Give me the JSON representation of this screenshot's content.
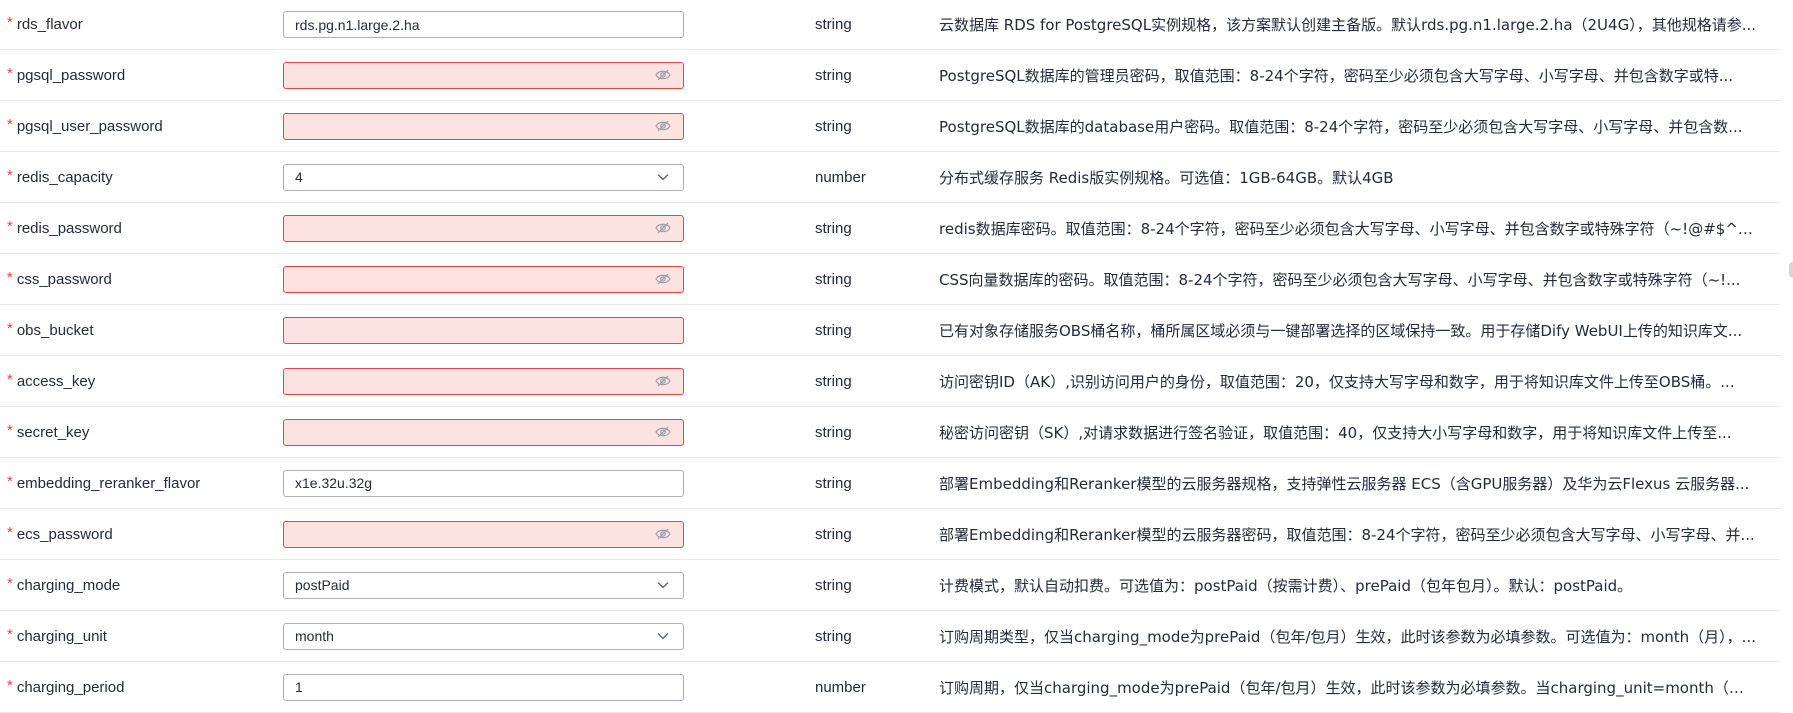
{
  "rows": [
    {
      "name": "rds_flavor",
      "kind": "text",
      "value": "rds.pg.n1.large.2.ha",
      "type": "string",
      "desc": "云数据库 RDS for PostgreSQL实例规格，该方案默认创建主备版。默认rds.pg.n1.large.2.ha（2U4G），其他规格请参..."
    },
    {
      "name": "pgsql_password",
      "kind": "password",
      "value": "",
      "type": "string",
      "desc": "PostgreSQL数据库的管理员密码，取值范围：8-24个字符，密码至少必须包含大写字母、小写字母、并包含数字或特..."
    },
    {
      "name": "pgsql_user_password",
      "kind": "password",
      "value": "",
      "type": "string",
      "desc": "PostgreSQL数据库的database用户密码。取值范围：8-24个字符，密码至少必须包含大写字母、小写字母、并包含数..."
    },
    {
      "name": "redis_capacity",
      "kind": "select",
      "value": "4",
      "type": "number",
      "desc": "分布式缓存服务 Redis版实例规格。可选值：1GB-64GB。默认4GB"
    },
    {
      "name": "redis_password",
      "kind": "password",
      "value": "",
      "type": "string",
      "desc": "redis数据库密码。取值范围：8-24个字符，密码至少必须包含大写字母、小写字母、并包含数字或特殊字符（~!@#$^*-..."
    },
    {
      "name": "css_password",
      "kind": "password",
      "value": "",
      "type": "string",
      "desc": "CSS向量数据库的密码。取值范围：8-24个字符，密码至少必须包含大写字母、小写字母、并包含数字或特殊字符（~!..."
    },
    {
      "name": "obs_bucket",
      "kind": "text-error",
      "value": "",
      "type": "string",
      "desc": "已有对象存储服务OBS桶名称，桶所属区域必须与一键部署选择的区域保持一致。用于存储Dify WebUI上传的知识库文..."
    },
    {
      "name": "access_key",
      "kind": "password",
      "value": "",
      "type": "string",
      "desc": "访问密钥ID（AK）,识别访问用户的身份，取值范围：20，仅支持大写字母和数字，用于将知识库文件上传至OBS桶。..."
    },
    {
      "name": "secret_key",
      "kind": "password",
      "value": "",
      "type": "string",
      "desc": "秘密访问密钥（SK）,对请求数据进行签名验证，取值范围：40，仅支持大小写字母和数字，用于将知识库文件上传至..."
    },
    {
      "name": "embedding_reranker_flavor",
      "kind": "text",
      "value": "x1e.32u.32g",
      "type": "string",
      "desc": "部署Embedding和Reranker模型的云服务器规格，支持弹性云服务器 ECS（含GPU服务器）及华为云Flexus 云服务器..."
    },
    {
      "name": "ecs_password",
      "kind": "password",
      "value": "",
      "type": "string",
      "desc": "部署Embedding和Reranker模型的云服务器密码，取值范围：8-24个字符，密码至少必须包含大写字母、小写字母、并..."
    },
    {
      "name": "charging_mode",
      "kind": "select",
      "value": "postPaid",
      "type": "string",
      "desc": "计费模式，默认自动扣费。可选值为：postPaid（按需计费）、prePaid（包年包月）。默认：postPaid。"
    },
    {
      "name": "charging_unit",
      "kind": "select",
      "value": "month",
      "type": "string",
      "desc": "订购周期类型，仅当charging_mode为prePaid（包年/包月）生效，此时该参数为必填参数。可选值为：month（月），..."
    },
    {
      "name": "charging_period",
      "kind": "text",
      "value": "1",
      "type": "number",
      "desc": "订购周期，仅当charging_mode为prePaid（包年/包月）生效，此时该参数为必填参数。当charging_unit=month（周期..."
    }
  ],
  "required_mark": "*",
  "icons": {
    "password_toggle": "eye-off-icon",
    "dropdown": "chevron-down-icon"
  },
  "colors": {
    "required": "#e54545",
    "error_border": "#e54545",
    "error_bg": "#fde2e2"
  }
}
